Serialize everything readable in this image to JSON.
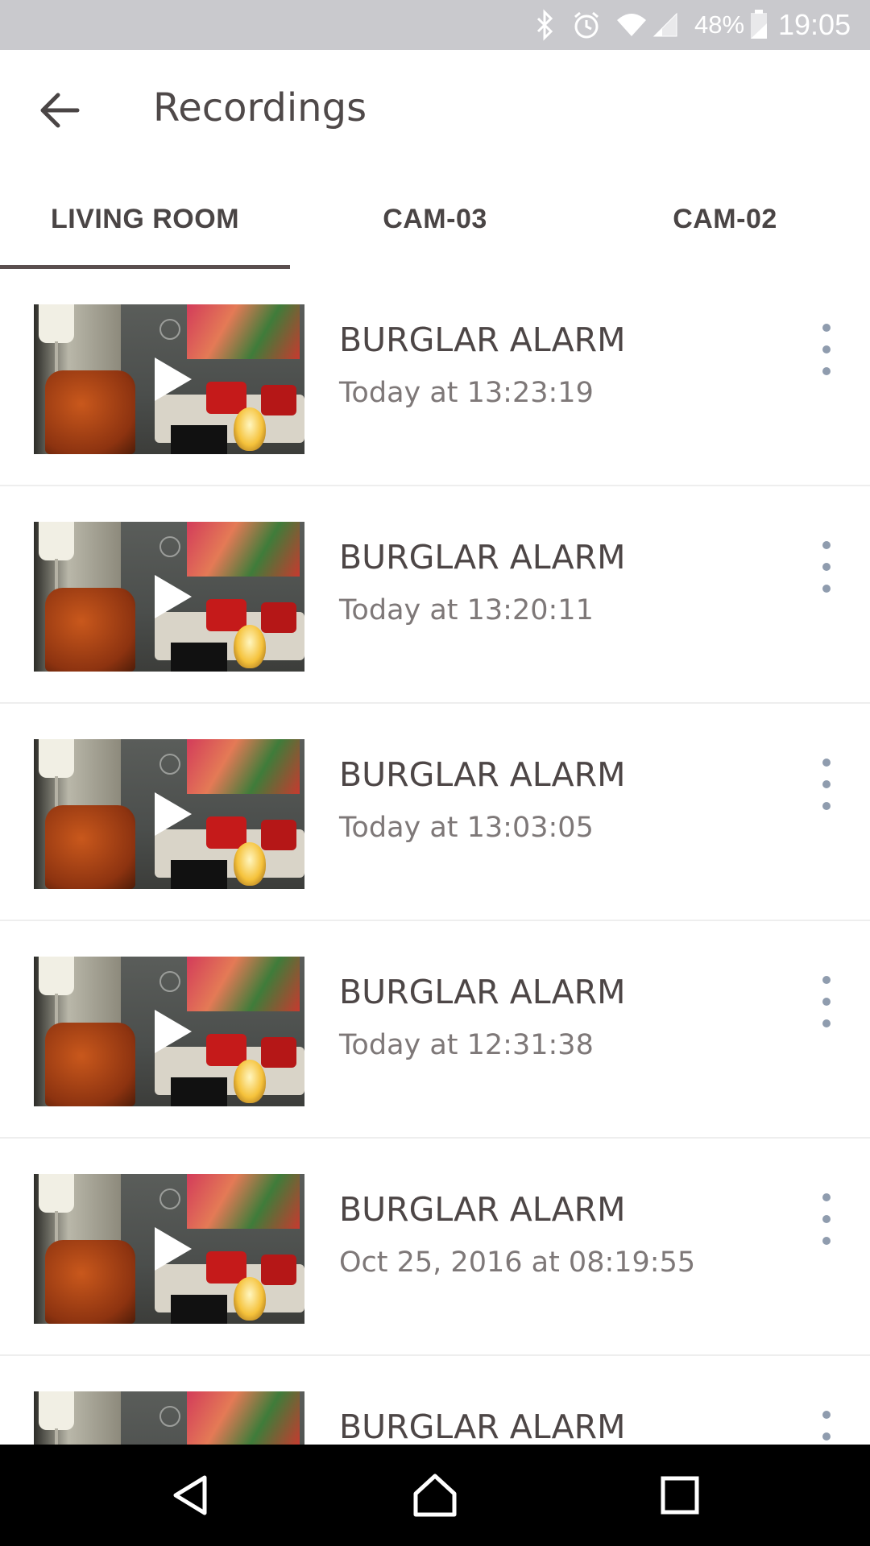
{
  "status_bar": {
    "battery": "48%",
    "time": "19:05",
    "icons": [
      "bluetooth-icon",
      "alarm-icon",
      "wifi-icon",
      "cell-signal-icon",
      "battery-icon"
    ]
  },
  "app_bar": {
    "back_icon": "arrow-left-icon",
    "title": "Recordings"
  },
  "tabs": [
    {
      "label": "LIVING ROOM",
      "selected": true
    },
    {
      "label": "CAM-03",
      "selected": false
    },
    {
      "label": "CAM-02",
      "selected": false
    }
  ],
  "recordings": [
    {
      "title": "BURGLAR ALARM",
      "time": "Today at 13:23:19"
    },
    {
      "title": "BURGLAR ALARM",
      "time": "Today at 13:20:11"
    },
    {
      "title": "BURGLAR ALARM",
      "time": "Today at 13:03:05"
    },
    {
      "title": "BURGLAR ALARM",
      "time": "Today at 12:31:38"
    },
    {
      "title": "BURGLAR ALARM",
      "time": "Oct 25, 2016 at 08:19:55"
    },
    {
      "title": "BURGLAR ALARM",
      "time": ""
    }
  ],
  "nav_bar": {
    "icons": [
      "back-triangle-icon",
      "home-icon",
      "recents-square-icon"
    ]
  },
  "colors": {
    "status_bar_bg": "#c9c9cd",
    "tab_indicator": "#5a4f4f",
    "overflow_dots": "#8f9cae",
    "text_primary": "#4d4646",
    "text_secondary": "#7e7878"
  }
}
